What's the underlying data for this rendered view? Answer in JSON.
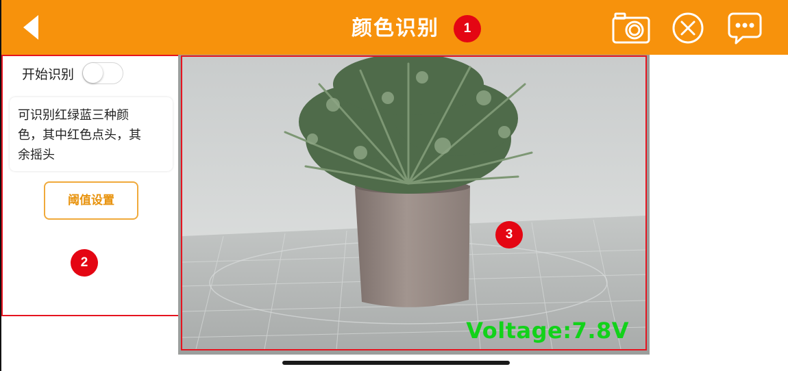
{
  "header": {
    "title": "颜色识别",
    "marker_1": "1",
    "background_color": "#f7920c",
    "icons": [
      "back-arrow-icon",
      "camera-icon",
      "close-circle-icon",
      "chat-more-icon"
    ]
  },
  "left_panel": {
    "toggle_label": "开始识别",
    "toggle_state": "off",
    "description": [
      "可识别红绿蓝三种颜",
      "色，其中红色点头，其",
      "余摇头"
    ],
    "threshold_button": "阈值设置",
    "marker_2": "2"
  },
  "camera": {
    "voltage_text": "Voltage:7.8V",
    "voltage_color": "#12d21a",
    "marker_3": "3"
  }
}
